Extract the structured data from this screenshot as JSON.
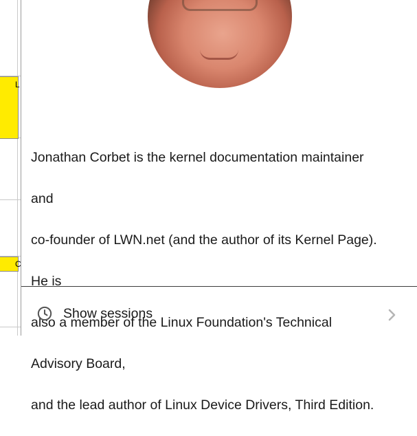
{
  "background": {
    "cell_1_text": "L",
    "cell_2_text": "C",
    "yellow": "#ffeb00"
  },
  "speaker": {
    "photo_alt": "Jonathan Corbet portrait",
    "bio_lines": [
      "Jonathan Corbet is the kernel documentation maintainer",
      "and",
      "co-founder of LWN.net (and the author of its Kernel Page).",
      "He is",
      "also a member of the Linux Foundation's Technical",
      "Advisory Board,",
      "and the lead author of Linux Device Drivers, Third Edition."
    ]
  },
  "sessions": {
    "label": "Show sessions",
    "icon": "clock-icon",
    "chevron": "chevron-right-icon"
  }
}
